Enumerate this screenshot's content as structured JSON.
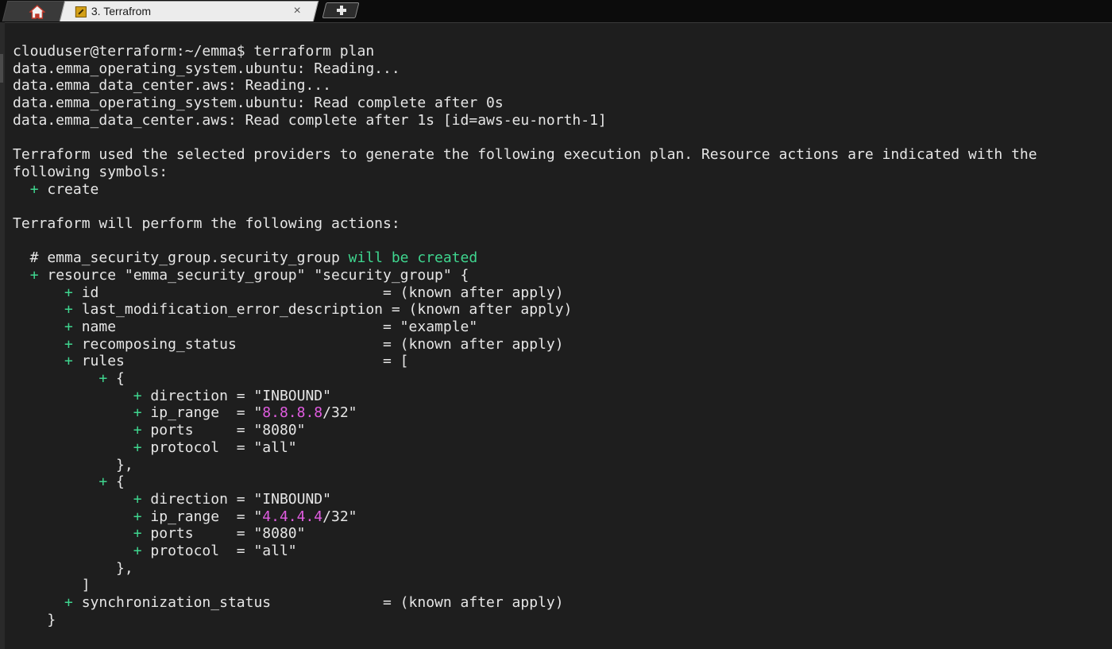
{
  "tabs": {
    "home_icon": "home-icon",
    "terminal_tab": {
      "icon": "tool-icon",
      "title": "3. Terrafrom",
      "close_glyph": "×"
    },
    "new_tab_icon": "plus-icon"
  },
  "colors": {
    "background": "#1e1e1e",
    "text": "#e6e6e6",
    "green": "#3fd68f",
    "magenta": "#e05ce0"
  },
  "terminal": {
    "lines": [
      [
        {
          "t": "clouduser@terraform:~/emma$ terraform plan"
        }
      ],
      [
        {
          "t": "data.emma_operating_system.ubuntu: Reading..."
        }
      ],
      [
        {
          "t": "data.emma_data_center.aws: Reading..."
        }
      ],
      [
        {
          "t": "data.emma_operating_system.ubuntu: Read complete after 0s"
        }
      ],
      [
        {
          "t": "data.emma_data_center.aws: Read complete after 1s [id=aws-eu-north-1]"
        }
      ],
      [],
      [
        {
          "t": "Terraform used the selected providers to generate the following execution plan. Resource actions are indicated with the"
        }
      ],
      [
        {
          "t": "following symbols:"
        }
      ],
      [
        {
          "t": "  "
        },
        {
          "t": "+",
          "c": "g"
        },
        {
          "t": " create"
        }
      ],
      [],
      [
        {
          "t": "Terraform will perform the following actions:"
        }
      ],
      [],
      [
        {
          "t": "  # emma_security_group.security_group "
        },
        {
          "t": "will be created",
          "c": "g"
        }
      ],
      [
        {
          "t": "  "
        },
        {
          "t": "+",
          "c": "g"
        },
        {
          "t": " resource \"emma_security_group\" \"security_group\" {"
        }
      ],
      [
        {
          "t": "      "
        },
        {
          "t": "+",
          "c": "g"
        },
        {
          "t": " id                                 = (known after apply)"
        }
      ],
      [
        {
          "t": "      "
        },
        {
          "t": "+",
          "c": "g"
        },
        {
          "t": " last_modification_error_description = (known after apply)"
        }
      ],
      [
        {
          "t": "      "
        },
        {
          "t": "+",
          "c": "g"
        },
        {
          "t": " name                               = \"example\""
        }
      ],
      [
        {
          "t": "      "
        },
        {
          "t": "+",
          "c": "g"
        },
        {
          "t": " recomposing_status                 = (known after apply)"
        }
      ],
      [
        {
          "t": "      "
        },
        {
          "t": "+",
          "c": "g"
        },
        {
          "t": " rules                              = ["
        }
      ],
      [
        {
          "t": "          "
        },
        {
          "t": "+",
          "c": "g"
        },
        {
          "t": " {"
        }
      ],
      [
        {
          "t": "              "
        },
        {
          "t": "+",
          "c": "g"
        },
        {
          "t": " direction = \"INBOUND\""
        }
      ],
      [
        {
          "t": "              "
        },
        {
          "t": "+",
          "c": "g"
        },
        {
          "t": " ip_range  = \""
        },
        {
          "t": "8.8.8.8",
          "c": "m"
        },
        {
          "t": "/32\""
        }
      ],
      [
        {
          "t": "              "
        },
        {
          "t": "+",
          "c": "g"
        },
        {
          "t": " ports     = \"8080\""
        }
      ],
      [
        {
          "t": "              "
        },
        {
          "t": "+",
          "c": "g"
        },
        {
          "t": " protocol  = \"all\""
        }
      ],
      [
        {
          "t": "            },"
        }
      ],
      [
        {
          "t": "          "
        },
        {
          "t": "+",
          "c": "g"
        },
        {
          "t": " {"
        }
      ],
      [
        {
          "t": "              "
        },
        {
          "t": "+",
          "c": "g"
        },
        {
          "t": " direction = \"INBOUND\""
        }
      ],
      [
        {
          "t": "              "
        },
        {
          "t": "+",
          "c": "g"
        },
        {
          "t": " ip_range  = \""
        },
        {
          "t": "4.4.4.4",
          "c": "m"
        },
        {
          "t": "/32\""
        }
      ],
      [
        {
          "t": "              "
        },
        {
          "t": "+",
          "c": "g"
        },
        {
          "t": " ports     = \"8080\""
        }
      ],
      [
        {
          "t": "              "
        },
        {
          "t": "+",
          "c": "g"
        },
        {
          "t": " protocol  = \"all\""
        }
      ],
      [
        {
          "t": "            },"
        }
      ],
      [
        {
          "t": "        ]"
        }
      ],
      [
        {
          "t": "      "
        },
        {
          "t": "+",
          "c": "g"
        },
        {
          "t": " synchronization_status             = (known after apply)"
        }
      ],
      [
        {
          "t": "    }"
        }
      ]
    ]
  }
}
